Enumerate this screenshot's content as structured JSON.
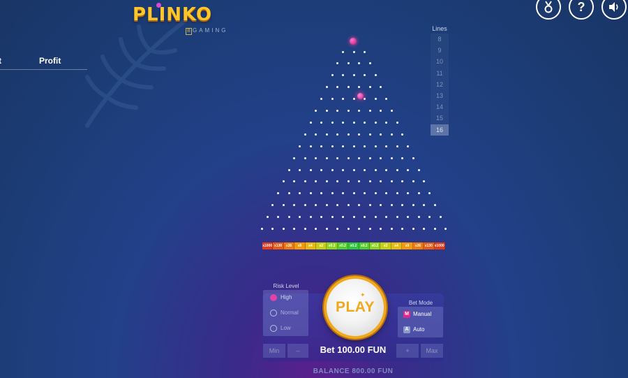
{
  "logo": {
    "title": "PLINKO",
    "sub_b": "B",
    "sub_text": "GAMING"
  },
  "history": {
    "col1": "t",
    "col2": "Profit"
  },
  "top_buttons": {
    "medal": "medal-icon",
    "help": "?",
    "sound": "speaker-icon"
  },
  "lines": {
    "title": "Lines",
    "options": [
      "8",
      "9",
      "10",
      "11",
      "12",
      "13",
      "14",
      "15",
      "16"
    ],
    "selected": "16"
  },
  "board": {
    "rows": 16
  },
  "multipliers": [
    {
      "label": "x1000",
      "color": "#e63a1a"
    },
    {
      "label": "x130",
      "color": "#ec5a12"
    },
    {
      "label": "x26",
      "color": "#f07a0c"
    },
    {
      "label": "x9",
      "color": "#f29a0a"
    },
    {
      "label": "x4",
      "color": "#e8bb0a"
    },
    {
      "label": "x2",
      "color": "#c8cf10"
    },
    {
      "label": "x0.2",
      "color": "#8ed41a"
    },
    {
      "label": "x0.2",
      "color": "#52cf26"
    },
    {
      "label": "x0.2",
      "color": "#2ec83a"
    },
    {
      "label": "x0.2",
      "color": "#52cf26"
    },
    {
      "label": "x0.2",
      "color": "#8ed41a"
    },
    {
      "label": "x2",
      "color": "#c8cf10"
    },
    {
      "label": "x4",
      "color": "#e8bb0a"
    },
    {
      "label": "x9",
      "color": "#f29a0a"
    },
    {
      "label": "x26",
      "color": "#f07a0c"
    },
    {
      "label": "x130",
      "color": "#ec5a12"
    },
    {
      "label": "x1000",
      "color": "#e63a1a"
    }
  ],
  "risk": {
    "title": "Risk Level",
    "items": [
      "High",
      "Normal",
      "Low"
    ],
    "selected": "High"
  },
  "play": {
    "label": "PLAY"
  },
  "bet_mode": {
    "title": "Bet Mode",
    "manual_icon": "M",
    "manual": "Manual",
    "auto_icon": "A",
    "auto": "Auto"
  },
  "bet": {
    "min": "Min",
    "minus": "–",
    "value": "Bet 100.00 FUN",
    "plus": "+",
    "max": "Max"
  },
  "balance": "BALANCE 800.00 FUN"
}
